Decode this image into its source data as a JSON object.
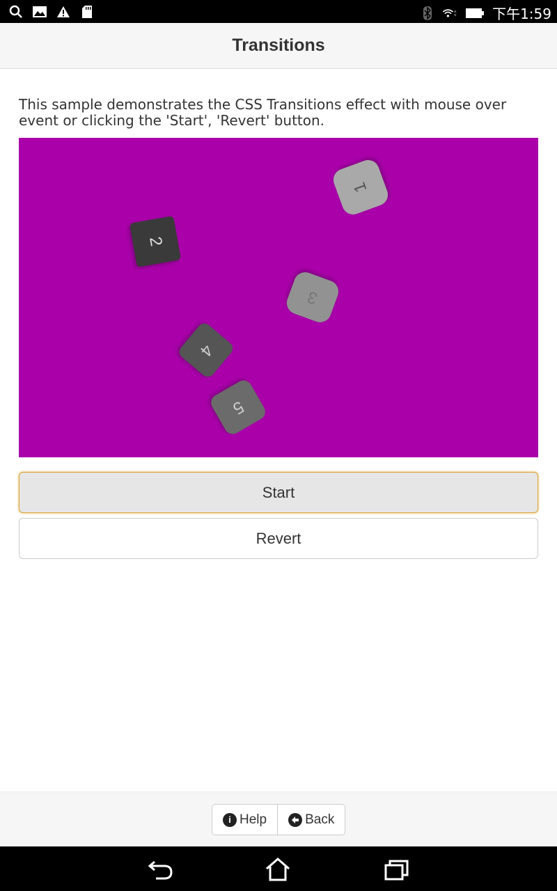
{
  "status_bar": {
    "time": "下午1:59",
    "left_icons": [
      "search-icon",
      "image-icon",
      "warning-icon",
      "sd-card-icon"
    ],
    "right_icons": [
      "bluetooth-icon",
      "wifi-icon",
      "battery-icon"
    ]
  },
  "header": {
    "title": "Transitions"
  },
  "description": "This sample demonstrates the CSS Transitions effect with mouse over event or clicking the 'Start', 'Revert' button.",
  "stage": {
    "background": "#aa00aa",
    "tiles": [
      {
        "label": "1",
        "color": "#a9a9a9",
        "text_color": "#555555"
      },
      {
        "label": "2",
        "color": "#3a3a3a",
        "text_color": "#dddddd"
      },
      {
        "label": "3",
        "color": "#929292",
        "text_color": "#777777"
      },
      {
        "label": "4",
        "color": "#555555",
        "text_color": "#cccccc"
      },
      {
        "label": "5",
        "color": "#6b6b6b",
        "text_color": "#cccccc"
      }
    ]
  },
  "buttons": {
    "start": "Start",
    "revert": "Revert"
  },
  "footer": {
    "help": "Help",
    "back": "Back"
  },
  "nav_bar": {
    "icons": [
      "back-icon",
      "home-icon",
      "recent-apps-icon"
    ]
  }
}
